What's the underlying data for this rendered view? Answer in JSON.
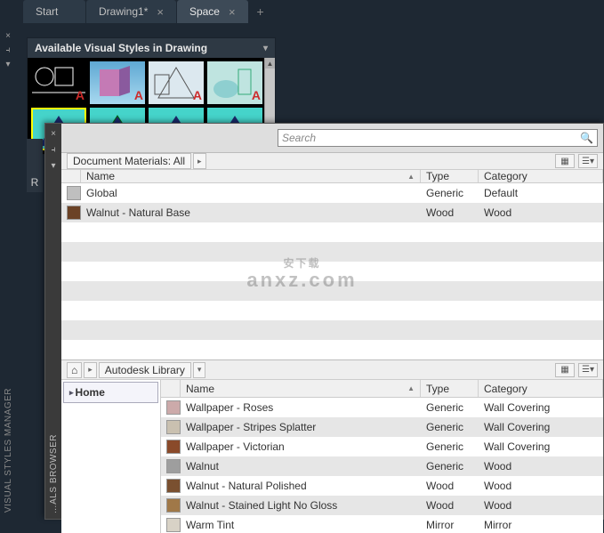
{
  "tabs": [
    {
      "label": "Start",
      "active": false,
      "closable": false
    },
    {
      "label": "Drawing1*",
      "active": false,
      "closable": true
    },
    {
      "label": "Space",
      "active": true,
      "closable": true
    }
  ],
  "vs_panel": {
    "title": "Available Visual Styles in Drawing"
  },
  "side_label": "VISUAL STYLES MANAGER",
  "r_label": "R",
  "mat": {
    "side_label": "…ALS BROWSER",
    "search_placeholder": "Search",
    "doc_breadcrumb": "Document Materials: All",
    "columns": {
      "name": "Name",
      "type": "Type",
      "category": "Category"
    },
    "doc_rows": [
      {
        "name": "Global",
        "type": "Generic",
        "category": "Default",
        "sw": "#bfbfbf"
      },
      {
        "name": "Walnut - Natural Base",
        "type": "Wood",
        "category": "Wood",
        "sw": "#6b4226"
      }
    ],
    "lib_breadcrumb": "Autodesk Library",
    "tree_item": "Home",
    "lib_rows": [
      {
        "name": "Wallpaper - Roses",
        "type": "Generic",
        "category": "Wall Covering",
        "sw": "#caa"
      },
      {
        "name": "Wallpaper - Stripes Splatter",
        "type": "Generic",
        "category": "Wall Covering",
        "sw": "#c9c0b0"
      },
      {
        "name": "Wallpaper - Victorian",
        "type": "Generic",
        "category": "Wall Covering",
        "sw": "#8a4a2a"
      },
      {
        "name": "Walnut",
        "type": "Generic",
        "category": "Wood",
        "sw": "#9e9e9e"
      },
      {
        "name": "Walnut - Natural Polished",
        "type": "Wood",
        "category": "Wood",
        "sw": "#7a5030"
      },
      {
        "name": "Walnut - Stained Light No Gloss",
        "type": "Wood",
        "category": "Wood",
        "sw": "#a07848"
      },
      {
        "name": "Warm Tint",
        "type": "Mirror",
        "category": "Mirror",
        "sw": "#d8d2c6"
      }
    ]
  },
  "watermark": {
    "main": "安下载",
    "sub": "anxz.com"
  }
}
